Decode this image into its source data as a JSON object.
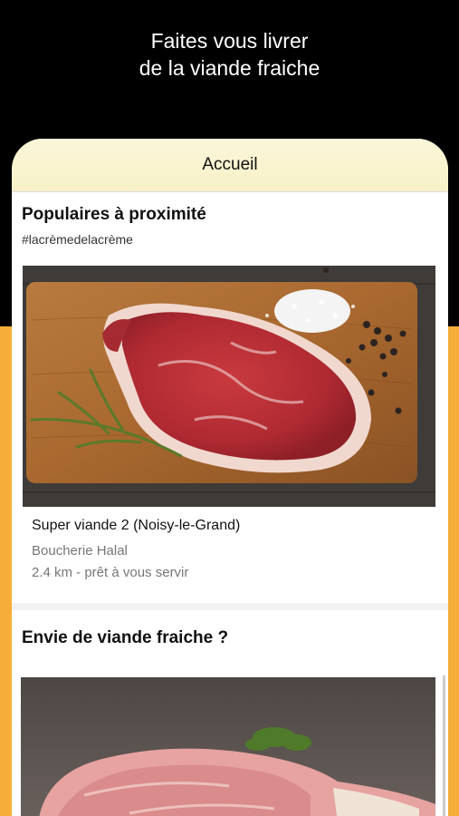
{
  "promo": {
    "caption_line1": "Faites vous livrer",
    "caption_line2": "de la viande fraiche"
  },
  "nav": {
    "title": "Accueil"
  },
  "popular": {
    "title": "Populaires à proximité",
    "hashtag": "#lacrèmedelacrème",
    "card": {
      "name": "Super viande 2 (Noisy-le-Grand)",
      "type": "Boucherie Halal",
      "distance": "2.4 km - prêt à vous servir"
    }
  },
  "fresh": {
    "title": "Envie de viande fraiche ?"
  },
  "colors": {
    "accent": "#f7ad3a",
    "nav_bg": "#f8f1c8"
  }
}
